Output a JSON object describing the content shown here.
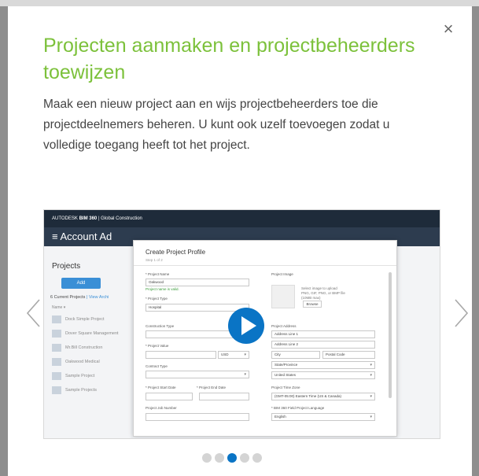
{
  "modal": {
    "title": "Projecten aanmaken en projectbeheerders toewijzen",
    "description": "Maak een nieuw project aan en wijs projectbeheerders toe die projectdeelnemers beheren. U kunt ook uzelf toevoegen zodat u volledige toegang heeft tot het project.",
    "close_symbol": "×"
  },
  "nav": {
    "prev_icon": "chevron-left-icon",
    "next_icon": "chevron-right-icon"
  },
  "screenshot": {
    "brand": "AUTODESK",
    "product": "BIM 360",
    "separator": "|",
    "org": "Global Construction",
    "band_title": "Account Ad",
    "projects_title": "Projects",
    "add_label": "Add",
    "count_text": "6 Current Projects",
    "count_link": "| View Archi",
    "name_header": "Name ▾",
    "projects": [
      "Dock Simple Project",
      "Dover Square Management",
      "Mr.Bill Construction",
      "Oakwood Medical",
      "Sample Project",
      "Sample Projects"
    ],
    "dialog": {
      "title": "Create Project Profile",
      "step": "Step 1 of 2",
      "project_name_label": "* Project Name",
      "project_name_value": "Oakwood",
      "project_name_hint": "Project name is valid.",
      "project_type_label": "* Project Type",
      "project_type_value": "Hospital",
      "construction_type_label": "Construction Type",
      "project_value_label": "* Project Value",
      "currency_value": "USD",
      "contract_type_label": "Contract Type",
      "start_date_label": "* Project Start Date",
      "end_date_label": "* Project End Date",
      "job_number_label": "Project Job Number",
      "image_label": "Project Image",
      "image_hint": "Select image to upload",
      "image_formats": "PNG, GIF, PNG, or BMP file",
      "image_size": "(10MB max)",
      "browse_label": "Browse",
      "address_label": "Project Address",
      "address1_placeholder": "Address Line 1",
      "address2_placeholder": "Address Line 2",
      "city_placeholder": "City",
      "postal_placeholder": "Postal Code",
      "state_value": "State/Province",
      "country_value": "United States",
      "timezone_label": "Project Time Zone",
      "timezone_value": "(GMT-05:00) Eastern Time (US & Canada)",
      "language_label": "* BIM 360 Field Project Language",
      "language_value": "English"
    }
  },
  "pagination": {
    "count": 5,
    "active_index": 2
  },
  "colors": {
    "title": "#7cc13b",
    "accent": "#0a74c5",
    "dot_inactive": "#d4d4d4"
  }
}
